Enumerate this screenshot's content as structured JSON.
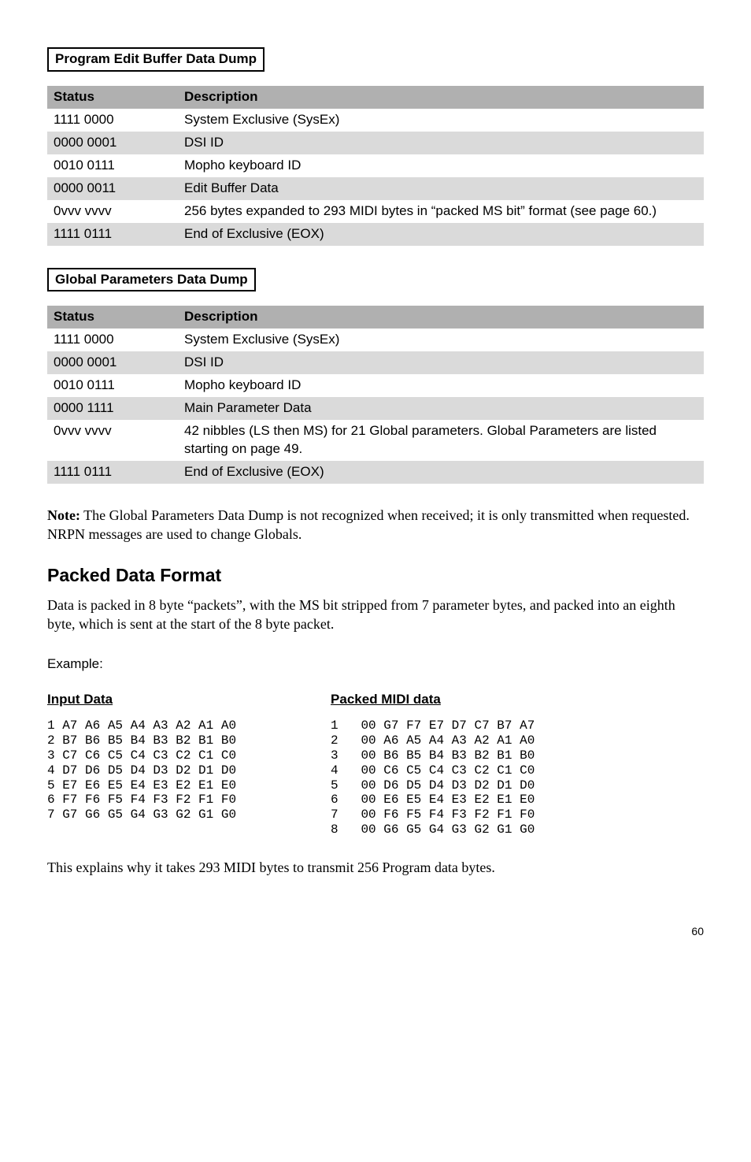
{
  "section1": {
    "label": "Program Edit Buffer Data Dump",
    "headers": {
      "status": "Status",
      "description": "Description"
    },
    "rows": [
      {
        "status": "1111 0000",
        "desc": "System Exclusive (SysEx)"
      },
      {
        "status": "0000 0001",
        "desc": "DSI ID"
      },
      {
        "status": "0010 0111",
        "desc": "Mopho keyboard ID"
      },
      {
        "status": "0000 0011",
        "desc": "Edit Buffer Data"
      },
      {
        "status": "0vvv vvvv",
        "desc": "256 bytes expanded to 293 MIDI bytes in “packed MS bit” format (see page 60.)"
      },
      {
        "status": "1111 0111",
        "desc": "End of Exclusive (EOX)"
      }
    ]
  },
  "section2": {
    "label": "Global Parameters Data Dump",
    "headers": {
      "status": "Status",
      "description": "Description"
    },
    "rows": [
      {
        "status": "1111 0000",
        "desc": "System Exclusive (SysEx)"
      },
      {
        "status": "0000 0001",
        "desc": "DSI ID"
      },
      {
        "status": "0010 0111",
        "desc": "Mopho keyboard ID"
      },
      {
        "status": "0000 1111",
        "desc": "Main Parameter Data"
      },
      {
        "status": "0vvv vvvv",
        "desc": "42 nibbles (LS then MS) for 21 Global parameters. Global Parameters are listed starting on page 49."
      },
      {
        "status": "1111 0111",
        "desc": "End of Exclusive (EOX)"
      }
    ]
  },
  "note": {
    "label": "Note:",
    "text": " The Global Parameters Data Dump is not recognized when received; it is only transmitted when requested. NRPN messages are used to change Globals."
  },
  "packed": {
    "heading": "Packed Data Format",
    "body": "Data is packed in 8 byte “packets”, with the MS bit stripped from 7 parameter bytes, and packed into an eighth byte, which is sent at the start of the 8 byte packet.",
    "example_label": "Example:",
    "input_title": "Input Data",
    "packed_title": "Packed MIDI data",
    "input_data": "1 A7 A6 A5 A4 A3 A2 A1 A0\n2 B7 B6 B5 B4 B3 B2 B1 B0\n3 C7 C6 C5 C4 C3 C2 C1 C0\n4 D7 D6 D5 D4 D3 D2 D1 D0\n5 E7 E6 E5 E4 E3 E2 E1 E0\n6 F7 F6 F5 F4 F3 F2 F1 F0\n7 G7 G6 G5 G4 G3 G2 G1 G0",
    "packed_data": "1   00 G7 F7 E7 D7 C7 B7 A7\n2   00 A6 A5 A4 A3 A2 A1 A0\n3   00 B6 B5 B4 B3 B2 B1 B0\n4   00 C6 C5 C4 C3 C2 C1 C0\n5   00 D6 D5 D4 D3 D2 D1 D0\n6   00 E6 E5 E4 E3 E2 E1 E0\n7   00 F6 F5 F4 F3 F2 F1 F0\n8   00 G6 G5 G4 G3 G2 G1 G0"
  },
  "footer_text": "This explains why it takes 293 MIDI bytes to transmit 256 Program data bytes.",
  "page_number": "60"
}
